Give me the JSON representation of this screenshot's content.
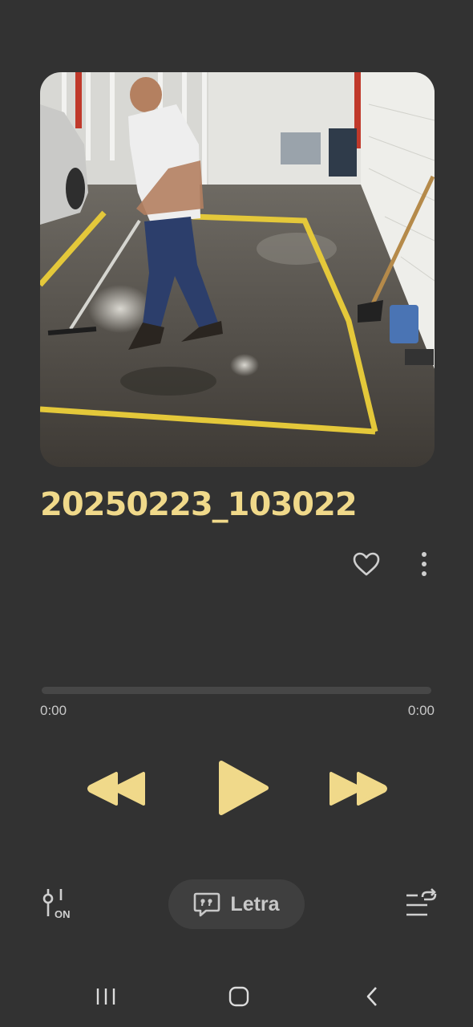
{
  "track": {
    "title": "20250223_103022",
    "artwork_icon": "album-art-photo"
  },
  "progress": {
    "current_time": "0:00",
    "total_time": "0:00",
    "fraction": 0.0
  },
  "controls": {
    "rewind_icon": "rewind-icon",
    "play_icon": "play-icon",
    "forward_icon": "fast-forward-icon",
    "favorite_icon": "heart-outline-icon",
    "more_icon": "more-vertical-icon"
  },
  "bottom_bar": {
    "equalizer_icon": "equalizer-on-icon",
    "equalizer_badge": "ON",
    "lyrics_label": "Letra",
    "lyrics_icon": "lyrics-quote-icon",
    "queue_icon": "queue-repeat-icon"
  },
  "colors": {
    "accent": "#f0d98a",
    "background": "#323232",
    "muted_text": "#c9c9c9",
    "pill_background": "#3f3f3f"
  },
  "navbar": {
    "recents_icon": "recents-icon",
    "home_icon": "home-icon",
    "back_icon": "back-icon"
  }
}
